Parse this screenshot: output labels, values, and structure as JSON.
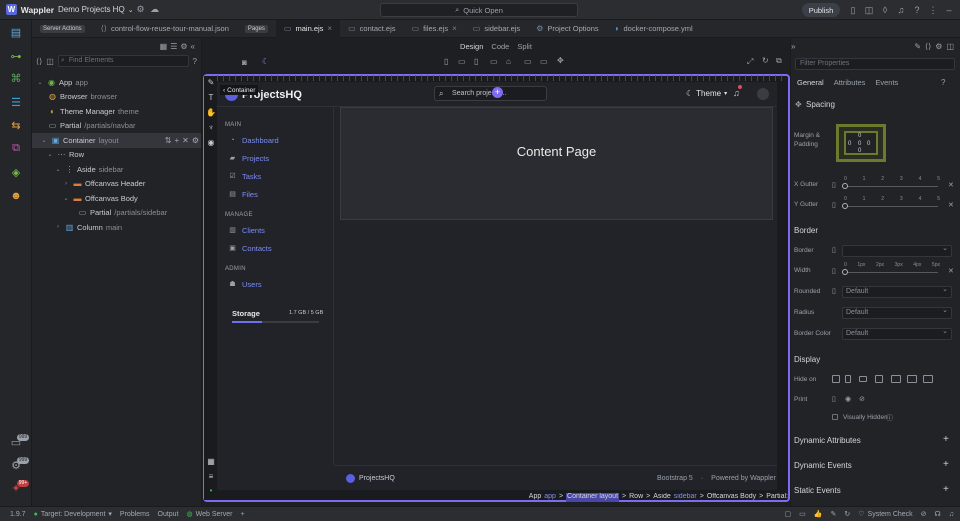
{
  "app": {
    "name": "Wappler",
    "project": "Demo Projects HQ",
    "quick_open": "Quick Open",
    "publish": "Publish"
  },
  "tabs": [
    {
      "label": "Server Actions",
      "kind": "mini"
    },
    {
      "label": "control-flow-reuse-tour-manual.json"
    },
    {
      "label": "Pages",
      "kind": "mini"
    },
    {
      "label": "main.ejs",
      "active": true
    },
    {
      "label": "contact.ejs"
    },
    {
      "label": "files.ejs"
    },
    {
      "label": "sidebar.ejs"
    },
    {
      "label": "Project Options"
    },
    {
      "label": "docker-compose.yml"
    }
  ],
  "tree": {
    "filter_placeholder": "Find Elements",
    "items": [
      {
        "label": "App",
        "sub": "app"
      },
      {
        "label": "Browser",
        "sub": "browser"
      },
      {
        "label": "Theme Manager",
        "sub": "theme"
      },
      {
        "label": "Partial",
        "sub": "/partials/navbar"
      },
      {
        "label": "Container",
        "sub": "layout"
      },
      {
        "label": "Row",
        "sub": ""
      },
      {
        "label": "Aside",
        "sub": "sidebar"
      },
      {
        "label": "Offcanvas Header",
        "sub": ""
      },
      {
        "label": "Offcanvas Body",
        "sub": ""
      },
      {
        "label": "Partial",
        "sub": "/partials/sidebar"
      },
      {
        "label": "Column",
        "sub": "main"
      }
    ]
  },
  "design_modes": [
    "Design",
    "Code",
    "Split"
  ],
  "webpage": {
    "brand": "ProjectsHQ",
    "container_tag": "Container",
    "search_placeholder": "Search projects...",
    "theme_label": "Theme",
    "sections": [
      {
        "heading": "MAIN",
        "links": [
          "Dashboard",
          "Projects",
          "Tasks",
          "Files"
        ]
      },
      {
        "heading": "MANAGE",
        "links": [
          "Clients",
          "Contacts"
        ]
      },
      {
        "heading": "ADMIN",
        "links": [
          "Users"
        ]
      }
    ],
    "storage": {
      "label": "Storage",
      "value": "1.7 GB / 5 GB",
      "fraction": 0.34
    },
    "content_title": "Content Page",
    "footer": {
      "brand": "ProjectsHQ",
      "stack": "Bootstrap 5",
      "sep": "·",
      "powered": "Powered by Wappler"
    }
  },
  "breadcrumb": [
    {
      "text": "App"
    },
    {
      "text": "app",
      "muted": true
    },
    {
      "text": ">"
    },
    {
      "text": "Container layout",
      "hl": true
    },
    {
      "text": ">"
    },
    {
      "text": "Row"
    },
    {
      "text": ">"
    },
    {
      "text": "Aside"
    },
    {
      "text": "sidebar",
      "muted": true
    },
    {
      "text": ">"
    },
    {
      "text": "Offcanvas Body"
    },
    {
      "text": ">"
    },
    {
      "text": "Partial:"
    }
  ],
  "props": {
    "filter_placeholder": "Filter Properties",
    "tabs": [
      "General",
      "Attributes",
      "Events"
    ],
    "spacing": {
      "title": "Spacing",
      "margin_label": "Margin & Padding",
      "values": [
        "0",
        "0",
        "0",
        "0",
        "0"
      ],
      "x_gutter": "X Gutter",
      "y_gutter": "Y Gutter",
      "gutter_ticks": [
        "0",
        "1",
        "2",
        "3",
        "4",
        "5"
      ]
    },
    "border": {
      "title": "Border",
      "border_label": "Border",
      "width_label": "Width",
      "width_ticks": [
        "0",
        "1px",
        "2px",
        "3px",
        "4px",
        "5px"
      ],
      "rounded_label": "Rounded",
      "radius_label": "Radius",
      "color_label": "Border Color",
      "default": "Default"
    },
    "display": {
      "title": "Display",
      "hide_on": "Hide on",
      "print": "Print",
      "visually_hidden": "Visually Hidden"
    },
    "sections": [
      "Dynamic Attributes",
      "Dynamic Events",
      "Static Events"
    ]
  },
  "status": {
    "version": "1.9.7",
    "target": "Target: Development",
    "problems": "Problems",
    "output": "Output",
    "web_server": "Web Server",
    "system_check": "System Check"
  },
  "badges": {
    "a": "999",
    "b": "999",
    "c": "99+"
  }
}
